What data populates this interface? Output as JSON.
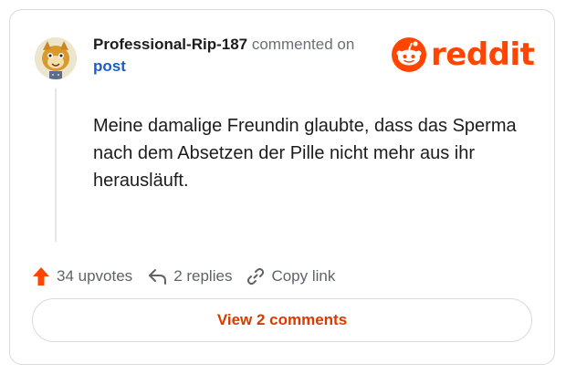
{
  "comment": {
    "username": "Professional-Rip-187",
    "action_text": "commented on",
    "post_link": "post",
    "body": "Meine damalige Freundin glaubte, dass das Sperma nach dem Absetzen der Pille nicht mehr aus ihr herausläuft."
  },
  "brand": {
    "wordmark": "reddit",
    "color": "#ff4500",
    "icon": "reddit-snoo-icon"
  },
  "actions": {
    "upvotes": "34 upvotes",
    "replies": "2 replies",
    "copy_link": "Copy link"
  },
  "view_comments_label": "View 2 comments",
  "colors": {
    "accent": "#ff4500",
    "link": "#1a5ec4",
    "button_text": "#d93a00"
  }
}
